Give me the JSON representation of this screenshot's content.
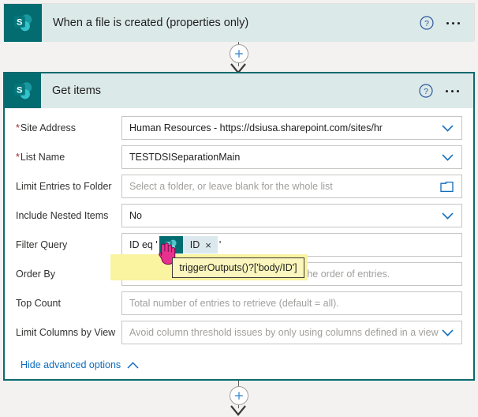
{
  "flow": {
    "trigger_card": {
      "title": "When a file is created (properties only)",
      "logo_letter": "S",
      "logo_name": "sharepoint-logo",
      "help_label": "?",
      "menu_label": "..."
    },
    "action_card": {
      "title": "Get items",
      "logo_letter": "S",
      "logo_name": "sharepoint-logo",
      "help_label": "?",
      "menu_label": "...",
      "fields": [
        {
          "label": "Site Address",
          "required": true,
          "value": "Human Resources - https://dsiusa.sharepoint.com/sites/hr",
          "placeholder": "",
          "control": "dropdown"
        },
        {
          "label": "List Name",
          "required": true,
          "value": "TESTDSISeparationMain",
          "placeholder": "",
          "control": "dropdown"
        },
        {
          "label": "Limit Entries to Folder",
          "required": false,
          "value": "",
          "placeholder": "Select a folder, or leave blank for the whole list",
          "control": "folder-picker"
        },
        {
          "label": "Include Nested Items",
          "required": false,
          "value": "No",
          "placeholder": "",
          "control": "dropdown"
        },
        {
          "label": "Filter Query",
          "required": false,
          "value": "",
          "placeholder": "",
          "control": "token-expression"
        },
        {
          "label": "Order By",
          "required": false,
          "value": "",
          "placeholder": "An ODATA orderBy query for specifying the order of entries.",
          "control": "text"
        },
        {
          "label": "Top Count",
          "required": false,
          "value": "",
          "placeholder": "Total number of entries to retrieve (default = all).",
          "control": "text"
        },
        {
          "label": "Limit Columns by View",
          "required": false,
          "value": "",
          "placeholder": "Avoid column threshold issues by only using columns defined in a view",
          "control": "dropdown"
        }
      ],
      "filter_query": {
        "prefix": "ID eq '",
        "token_label": "ID",
        "token_remove": "×",
        "suffix": "'"
      },
      "advanced_toggle": {
        "label": "Hide advanced options",
        "chevron": "chevron-up"
      }
    },
    "connectors": {
      "top_plus_label": "+",
      "bottom_plus_label": "+"
    },
    "tooltip": {
      "text": "triggerOutputs()?['body/ID']"
    }
  },
  "colors": {
    "sharepoint_teal": "#036c70",
    "card_header_bg": "#dce9e9",
    "selected_border": "#0b6a6e",
    "accent_blue": "#0f6cbd",
    "required_red": "#a4262c",
    "highlight_yellow": "#faf3a0",
    "tooltip_bg": "#fbf6bd"
  }
}
